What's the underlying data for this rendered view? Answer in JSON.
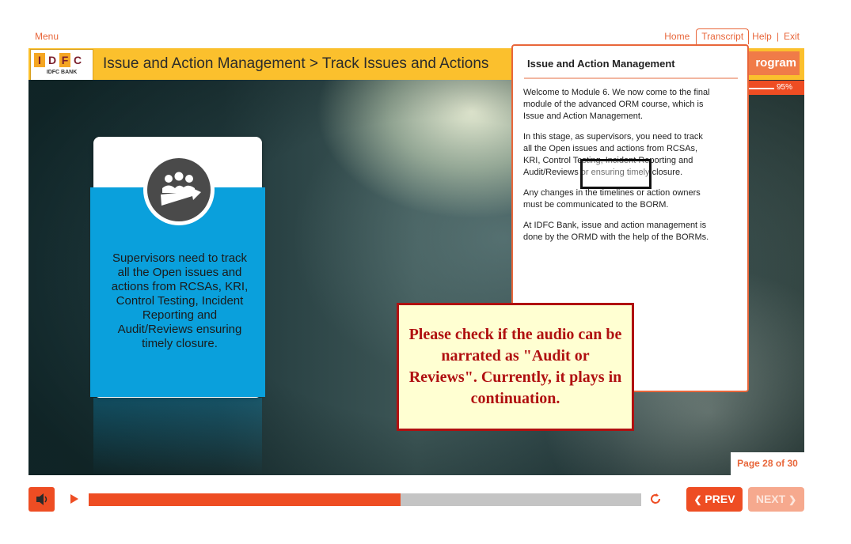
{
  "nav": {
    "menu": "Menu",
    "home": "Home",
    "transcript": "Transcript",
    "help": "Help",
    "exit": "Exit",
    "separator": "|"
  },
  "header": {
    "logo_letters": [
      "I",
      "D",
      "F",
      "C"
    ],
    "logo_subtitle": "IDFC BANK",
    "title": "Issue and Action Management > Track Issues and Actions",
    "program_label": "rogram",
    "progress_percent": "95%"
  },
  "card": {
    "icon": "team-progress-icon",
    "text": "Supervisors need to track all the Open issues and actions from RCSAs, KRI, Control Testing, Incident Reporting and Audit/Reviews ensuring timely closure."
  },
  "transcript": {
    "title": "Issue and Action Management",
    "paragraphs": [
      "Welcome to Module 6. We now come to the final module of the advanced ORM course, which is Issue and Action Management.",
      "In this stage, as supervisors, you need to track all the Open issues and actions from RCSAs, KRI, Control Testing, Incident Reporting and Audit/Reviews or ensuring timely closure.",
      "Any changes in the timelines or action owners must be communicated to the BORM.",
      "At IDFC Bank, issue and action management is done by the ORMD with the help of the BORMs."
    ],
    "highlight_text": "Audit/Reviews"
  },
  "review_note": "Please check if the audio can be narrated as \"Audit or Reviews\". Currently, it plays in continuation.",
  "page_indicator": "Page 28 of 30",
  "player": {
    "seek_progress": 0.564,
    "prev_label": "PREV",
    "next_label": "NEXT",
    "mute_icon": "speaker-icon",
    "play_icon": "play-icon",
    "replay_icon": "replay-icon"
  },
  "colors": {
    "accent": "#ee4d23",
    "header": "#fbc02d",
    "card_blue": "#0aa0dc",
    "note_red": "#b01010"
  }
}
